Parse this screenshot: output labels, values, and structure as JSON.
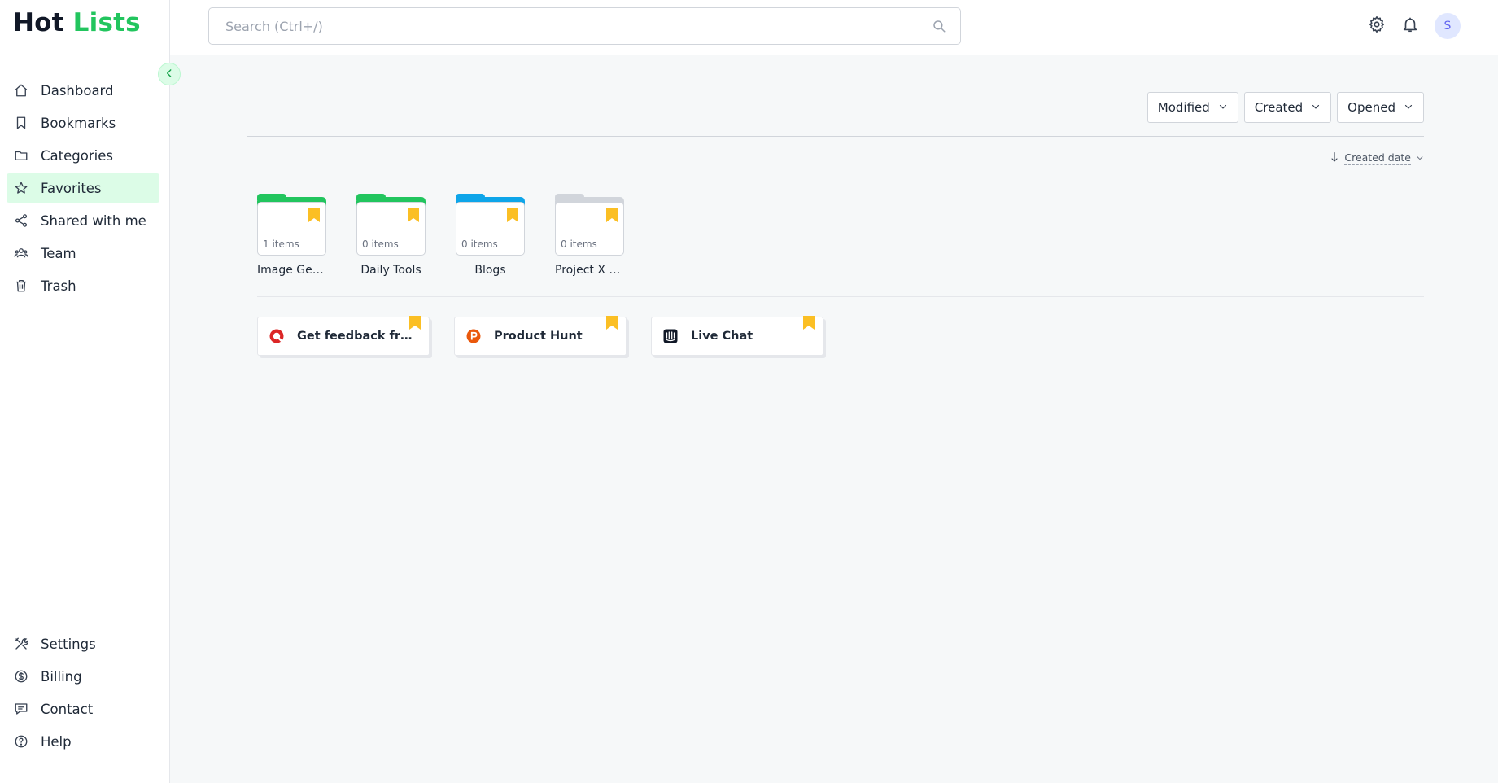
{
  "app": {
    "logo_part1": "Hot",
    "logo_part2": "Lists"
  },
  "colors": {
    "accent": "#22c55e",
    "active_bg": "#dcfce7",
    "bookmark": "#fbbf24"
  },
  "search": {
    "placeholder": "Search (Ctrl+/)",
    "value": ""
  },
  "header": {
    "avatar_initial": "S"
  },
  "sidebar": {
    "items": [
      {
        "label": "Dashboard",
        "icon": "home-icon"
      },
      {
        "label": "Bookmarks",
        "icon": "bookmark-icon"
      },
      {
        "label": "Categories",
        "icon": "folder-icon"
      },
      {
        "label": "Favorites",
        "icon": "star-icon",
        "active": true
      },
      {
        "label": "Shared with me",
        "icon": "share-icon"
      },
      {
        "label": "Team",
        "icon": "team-icon"
      },
      {
        "label": "Trash",
        "icon": "trash-icon"
      }
    ],
    "bottom_items": [
      {
        "label": "Settings",
        "icon": "tools-icon"
      },
      {
        "label": "Billing",
        "icon": "dollar-icon"
      },
      {
        "label": "Contact",
        "icon": "chat-icon"
      },
      {
        "label": "Help",
        "icon": "help-icon"
      }
    ]
  },
  "filters": [
    {
      "label": "Modified"
    },
    {
      "label": "Created"
    },
    {
      "label": "Opened"
    }
  ],
  "sort": {
    "label": "Created date"
  },
  "folders": [
    {
      "name": "Image Gen...",
      "count": "1 items",
      "color": "#22c55e"
    },
    {
      "name": "Daily Tools",
      "count": "0 items",
      "color": "#22c55e"
    },
    {
      "name": "Blogs",
      "count": "0 items",
      "color": "#0ea5e9"
    },
    {
      "name": "Project X Li...",
      "count": "0 items",
      "color": "#d1d5db"
    }
  ],
  "bookmarks": [
    {
      "title": "Get feedback from ...",
      "favicon": "qualaroo-icon"
    },
    {
      "title": "Product Hunt",
      "favicon": "product-hunt-icon"
    },
    {
      "title": "Live Chat",
      "favicon": "intercom-icon"
    }
  ]
}
